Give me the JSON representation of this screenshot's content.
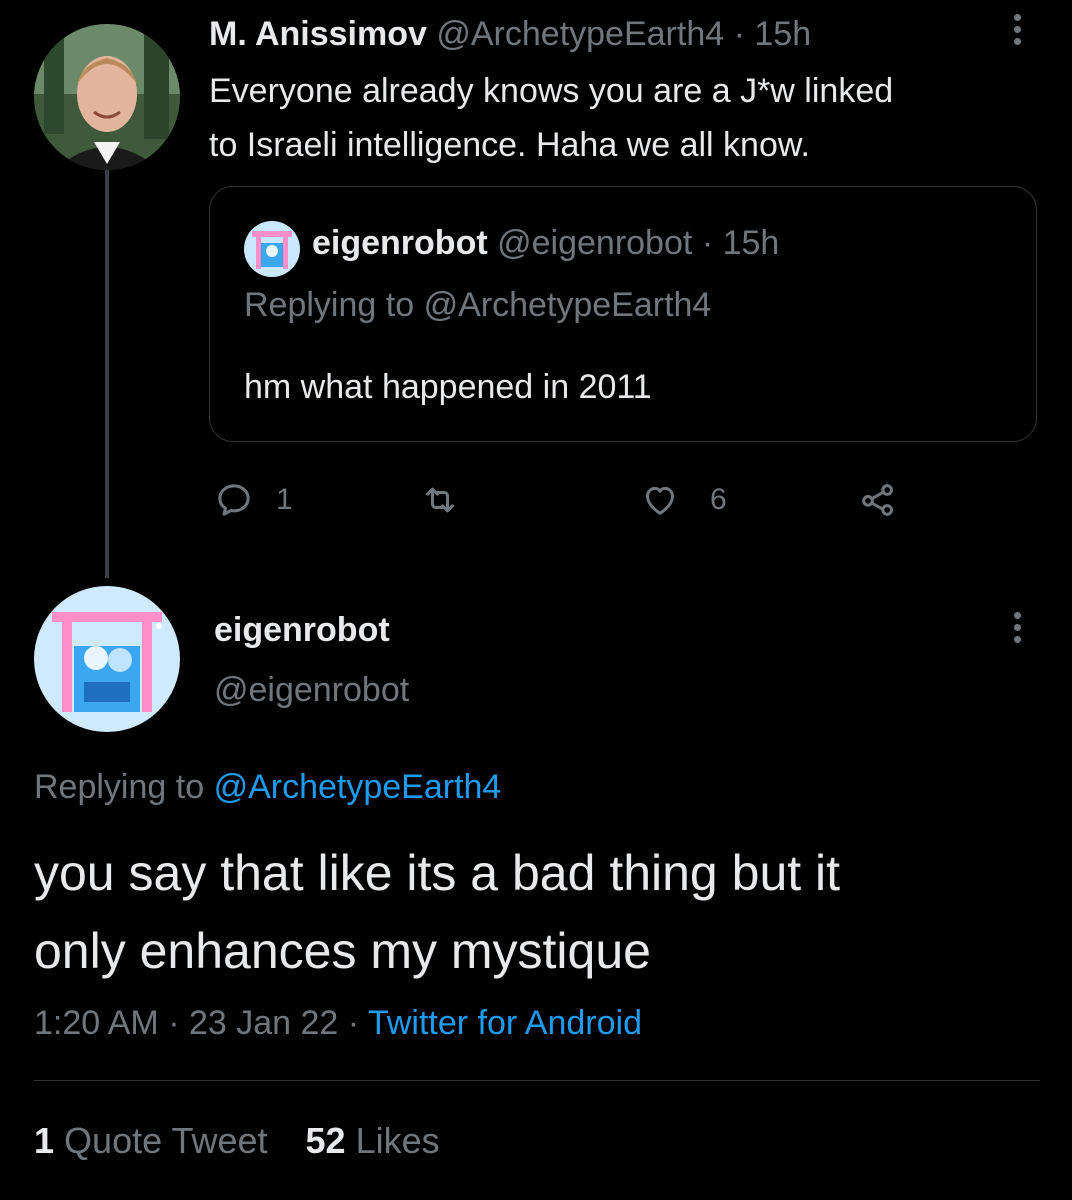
{
  "parent_tweet": {
    "author_name": "M. Anissimov",
    "author_handle": "@ArchetypeEarth4",
    "separator": "·",
    "time": "15h",
    "text_line1": "Everyone already knows you are a J*w linked",
    "text_line2": "to Israeli intelligence. Haha we all know.",
    "quoted": {
      "author_name": "eigenrobot",
      "author_handle": "@eigenrobot",
      "separator": "·",
      "time": "15h",
      "replying_prefix": "Replying to",
      "replying_handle": "@ArchetypeEarth4",
      "text": "hm what happened in 2011"
    },
    "actions": {
      "reply_icon": "reply-icon",
      "reply_count": "1",
      "retweet_icon": "retweet-icon",
      "like_icon": "heart-icon",
      "like_count": "6",
      "share_icon": "share-icon"
    }
  },
  "main_tweet": {
    "author_name": "eigenrobot",
    "author_handle": "@eigenrobot",
    "replying_prefix": "Replying to",
    "replying_handle": "@ArchetypeEarth4",
    "text_line1": "you say that like its a bad thing but it",
    "text_line2": "only enhances my mystique",
    "time": "1:20 AM",
    "sep1": "·",
    "date": "23 Jan 22",
    "sep2": "·",
    "source": "Twitter for Android"
  },
  "stats": {
    "quote_count": "1",
    "quote_label": "Quote Tweet",
    "likes_count": "52",
    "likes_label": "Likes"
  },
  "colors": {
    "background": "#000000",
    "text": "#e7e9ea",
    "muted": "#71767b",
    "link": "#1d9bf0",
    "border": "#2f3336"
  }
}
